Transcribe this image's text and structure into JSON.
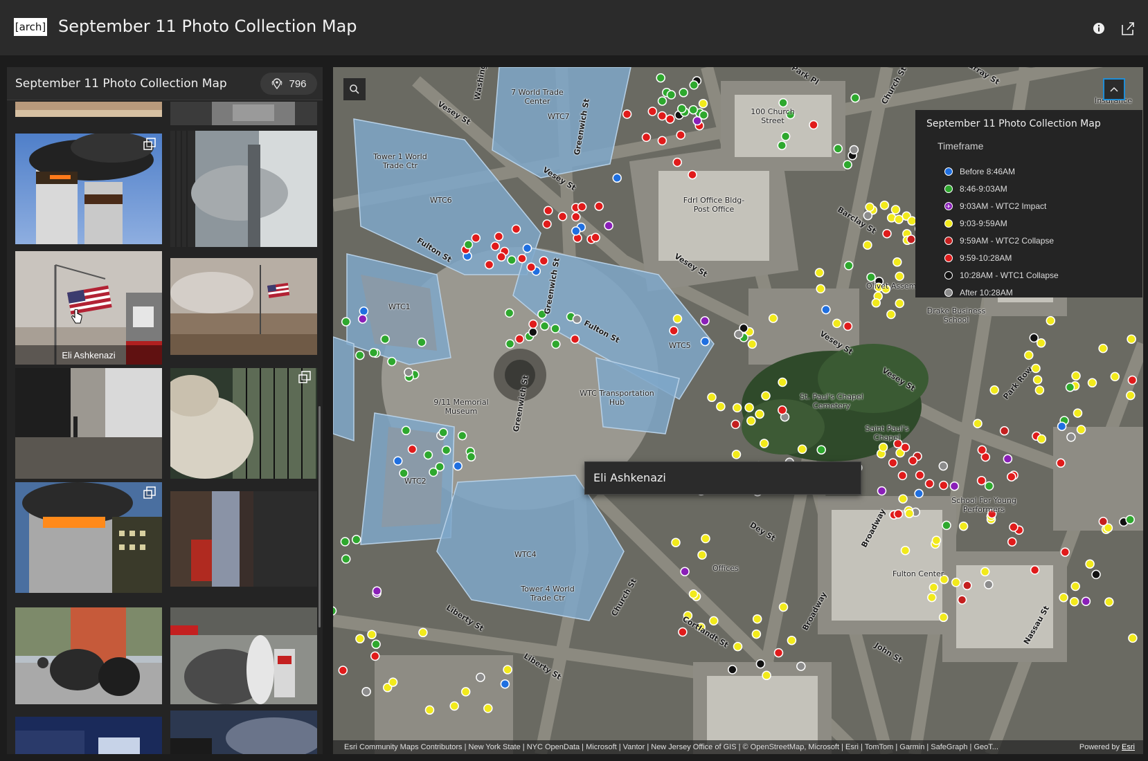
{
  "header": {
    "logo_text": "[arch]",
    "title": "September 11 Photo Collection Map",
    "info_icon": "info-icon",
    "share_icon": "share-icon"
  },
  "sidebar": {
    "title": "September 11 Photo Collection Map",
    "count": "796",
    "count_icon": "map-pin-group-icon",
    "hover_caption": "Eli Ashkenazi"
  },
  "map": {
    "search_icon": "search-icon",
    "legend_toggle_icon": "chevron-up-icon",
    "tooltip": "Eli Ashkenazi",
    "attribution": "Esri Community Maps Contributors | New York State | NYC OpenData | Microsoft | Vantor | New Jersey Office of GIS | © OpenStreetMap, Microsoft | Esri | TomTom | Garmin | SafeGraph | GeoT...",
    "powered_by": "Powered by",
    "powered_link": "Esri",
    "labels": {
      "wtc7": "7 World Trade Center",
      "wtc7short": "WTC7",
      "church100": "100 Church Street",
      "tower1": "Tower 1 World Trade Ctr",
      "wtc6": "WTC6",
      "wtc1": "WTC1",
      "fdr": "Fdrl Office Bldg-Post Office",
      "wtc5": "WTC5",
      "memorial": "9/11 Memorial Museum",
      "transport": "WTC Transportation Hub",
      "wtc2": "WTC2",
      "wtc4": "WTC4",
      "tower4": "Tower 4 World Trade Ctr",
      "stpauls": "St. Paul's Chapel Cemetery",
      "saintpaul": "Saint Paul's Chapel",
      "drake": "Drake Business School",
      "school": "School For Young Performers",
      "offices": "Offices",
      "fulton_center": "Fulton Center",
      "olivet": "Olivet Assembly",
      "insurance": "Insurance"
    },
    "streets": {
      "vesey1": "Vesey St",
      "vesey2": "Vesey St",
      "vesey3": "Vesey St",
      "vesey4": "Vesey St",
      "fulton1": "Fulton St",
      "fulton2": "Fulton St",
      "greenwich1": "Greenwich St",
      "greenwich2": "Greenwich St",
      "greenwich3": "Greenwich St",
      "church": "Church St",
      "church2": "Church St",
      "barclay": "Barclay St",
      "parkpl": "Park Pl",
      "liberty1": "Liberty St",
      "liberty2": "Liberty St",
      "cortlandt": "Cortlandt St",
      "broadway": "Broadway",
      "john": "John St",
      "nassau": "Nassau St",
      "parkrow": "Park Row",
      "washington": "Washing",
      "murray": "Murray St",
      "dey": "Dey St"
    }
  },
  "legend": {
    "title": "September 11 Photo Collection Map",
    "subtitle": "Timeframe",
    "items": [
      {
        "label": "Before 8:46AM",
        "color": "#1f6fe0"
      },
      {
        "label": "8:46-9:03AM",
        "color": "#2ea82e"
      },
      {
        "label": "9:03AM - WTC2 Impact",
        "color": "#8a1fb8"
      },
      {
        "label": "9:03-9:59AM",
        "color": "#f2ea1b"
      },
      {
        "label": "9:59AM - WTC2 Collapse",
        "color": "#c41f1f"
      },
      {
        "label": "9:59-10:28AM",
        "color": "#e01b1b"
      },
      {
        "label": "10:28AM - WTC1 Collapse",
        "color": "#111111"
      },
      {
        "label": "After 10:28AM",
        "color": "#8c8c8c"
      }
    ]
  }
}
